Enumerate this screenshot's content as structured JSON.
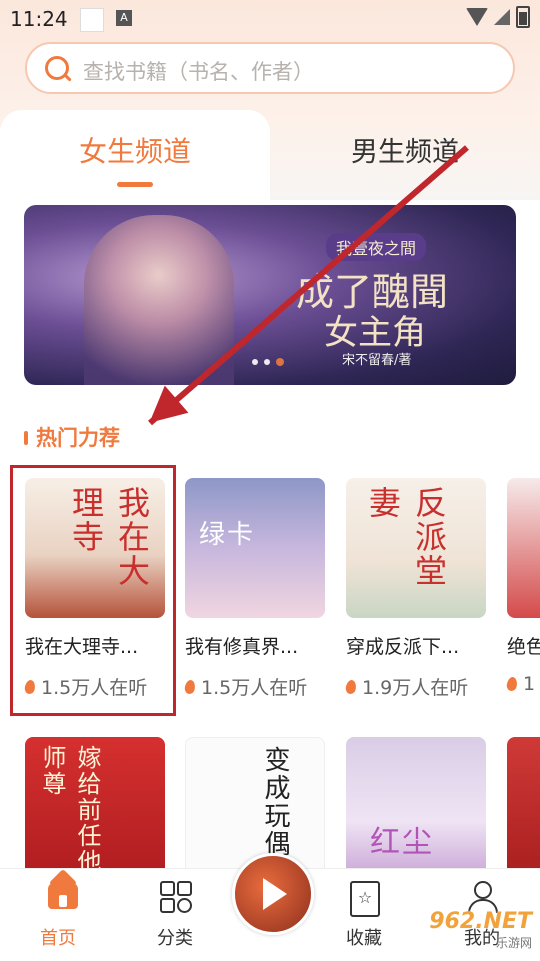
{
  "status": {
    "time": "11:24",
    "app_badge": "A"
  },
  "search": {
    "placeholder": "查找书籍（书名、作者）"
  },
  "tabs": [
    {
      "label": "女生频道",
      "active": true
    },
    {
      "label": "男生频道",
      "active": false
    }
  ],
  "banner": {
    "tag": "我壹夜之間",
    "title_line1": "成了醜聞",
    "title_line2": "女主角",
    "author": "宋不留春/著",
    "dots_total": 3,
    "dots_active_index": 2
  },
  "section": {
    "title": "热门力荐"
  },
  "books_row1": [
    {
      "title": "我在大理寺...",
      "listeners": "1.5万人在听",
      "cover_text": "我在大理寺",
      "cover_color": "#f3e3d2"
    },
    {
      "title": "我有修真界...",
      "listeners": "1.5万人在听",
      "cover_text": "绿卡",
      "cover_color": "#a9b5d8"
    },
    {
      "title": "穿成反派下...",
      "listeners": "1.9万人在听",
      "cover_text": "反派堂妻",
      "cover_color": "#f4ede6"
    },
    {
      "title": "绝色",
      "listeners": "1",
      "cover_text": "",
      "cover_color": "#f1dede"
    }
  ],
  "books_row2": [
    {
      "cover_text": "嫁给前任他师尊",
      "cover_color": "#c8262a"
    },
    {
      "cover_text": "变成玩偶",
      "cover_color": "#fafafa"
    },
    {
      "cover_text": "红尘",
      "cover_color": "#e8dff3"
    },
    {
      "cover_text": "",
      "cover_color": "#c23534"
    }
  ],
  "bottom_nav": [
    {
      "label": "首页",
      "icon": "home-icon",
      "active": true
    },
    {
      "label": "分类",
      "icon": "category-grid-icon",
      "active": false
    },
    {
      "label": "",
      "icon": "play-icon",
      "active": false
    },
    {
      "label": "收藏",
      "icon": "bookmark-star-icon",
      "active": false
    },
    {
      "label": "我的",
      "icon": "user-icon",
      "active": false
    }
  ],
  "watermark": {
    "main": "962.NET",
    "sub": "乐游网"
  },
  "colors": {
    "accent": "#f07a3e",
    "annotation_red": "#c0272d"
  }
}
